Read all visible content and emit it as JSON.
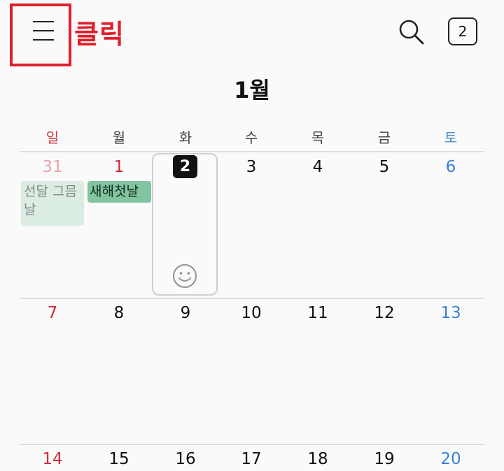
{
  "header": {
    "click_annotation": "클릭",
    "today_badge": "2",
    "month_title": "1월",
    "highlight_color": "#e0202c"
  },
  "weekdays": [
    "일",
    "월",
    "화",
    "수",
    "목",
    "금",
    "토"
  ],
  "weeks": [
    [
      "31",
      "1",
      "2",
      "3",
      "4",
      "5",
      "6"
    ],
    [
      "7",
      "8",
      "9",
      "10",
      "11",
      "12",
      "13"
    ],
    [
      "14",
      "15",
      "16",
      "17",
      "18",
      "19",
      "20"
    ]
  ],
  "events": {
    "prev_month": "선달 그믐날",
    "new_year": "새해첫날"
  },
  "colors": {
    "sunday": "#cc2c36",
    "saturday": "#3a80d4",
    "event_green": "#83c4a0",
    "event_faded": "#dbece3"
  }
}
